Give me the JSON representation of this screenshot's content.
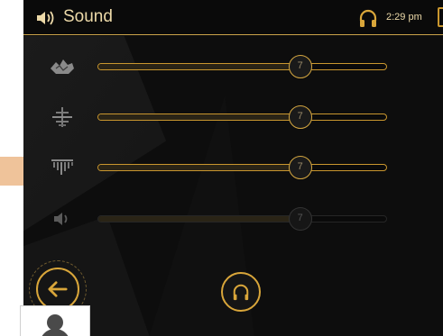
{
  "header": {
    "title_icon": "speaker-icon",
    "title": "Sound",
    "headphone_icon": "headphone-icon",
    "time": "2:29 pm",
    "battery_icon": "battery-icon"
  },
  "sliders": [
    {
      "icon": "bass-icon",
      "value": "7",
      "level": 0.7,
      "enabled": true
    },
    {
      "icon": "midrange-icon",
      "value": "7",
      "level": 0.7,
      "enabled": true
    },
    {
      "icon": "treble-icon",
      "value": "7",
      "level": 0.7,
      "enabled": true
    },
    {
      "icon": "volume-icon",
      "value": "7",
      "level": 0.7,
      "enabled": false
    }
  ],
  "footer": {
    "back_icon": "back-arrow-icon",
    "headphone_button_icon": "headphone-icon"
  },
  "colors": {
    "accent": "#d9a63a",
    "title_text": "#ecd9a8",
    "background": "#0d0d0d"
  }
}
